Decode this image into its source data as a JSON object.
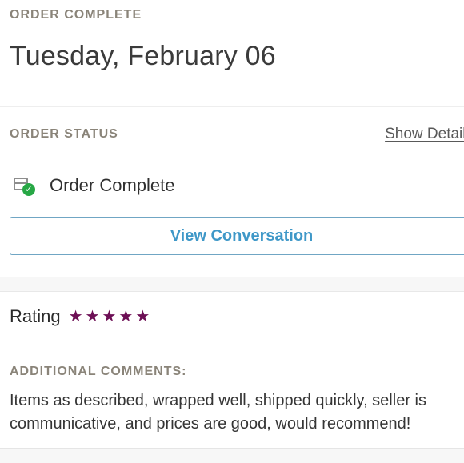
{
  "order": {
    "eyebrow": "ORDER COMPLETE",
    "date": "Tuesday, February 06"
  },
  "status": {
    "eyebrow": "ORDER STATUS",
    "show_details": "Show Details",
    "state_icon": "box-checked-icon",
    "state_text": "Order Complete",
    "check_glyph": "✓"
  },
  "actions": {
    "view_conversation": "View Conversation"
  },
  "rating": {
    "label": "Rating",
    "stars": 5,
    "star_glyph": "★",
    "star_color": "#6d0f55"
  },
  "comments": {
    "label": "ADDITIONAL COMMENTS:",
    "line1": "Items as described, wrapped well, shipped quickly, seller is",
    "line2": "communicative, and prices are good, would recommend!"
  },
  "colors": {
    "accent_blue": "#3f98c8",
    "success_green": "#27a745",
    "muted_label": "#8a8479"
  }
}
